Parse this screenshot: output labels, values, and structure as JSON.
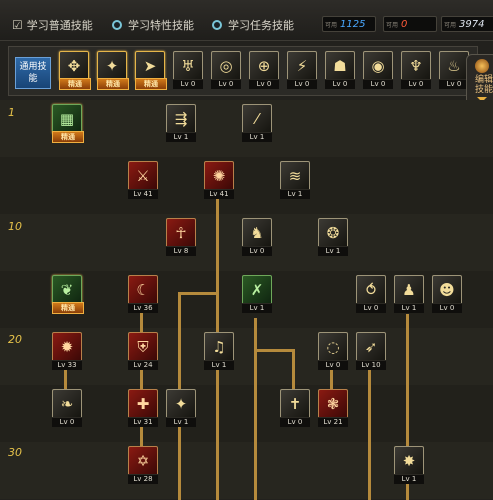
{
  "tabs": [
    {
      "label": "学习普通技能",
      "style": "checkbox"
    },
    {
      "label": "学习特性技能",
      "style": "radio"
    },
    {
      "label": "学习任务技能",
      "style": "radio"
    }
  ],
  "points": [
    {
      "label": "可用",
      "value": "1125",
      "color": "#4aa8ff"
    },
    {
      "label": "可用",
      "value": "0",
      "color": "#ff5a3a"
    },
    {
      "label": "可用",
      "value": "3974",
      "color": "#dfe6f0"
    }
  ],
  "common_label": "通用技能",
  "side_button": "编辑技能",
  "master_label": "精通",
  "level_markers": [
    "1",
    "10",
    "20",
    "30"
  ],
  "common_skills": [
    {
      "icon": "meditate-icon",
      "glyph": "✥",
      "lv": "精通",
      "master": true
    },
    {
      "icon": "leap-icon",
      "glyph": "✦",
      "lv": "精通",
      "master": true
    },
    {
      "icon": "dash-icon",
      "glyph": "➤",
      "lv": "精通",
      "master": true
    },
    {
      "icon": "wings-icon",
      "glyph": "♅",
      "lv": "Lv 0"
    },
    {
      "icon": "target-icon",
      "glyph": "◎",
      "lv": "Lv 0"
    },
    {
      "icon": "crosshair-icon",
      "glyph": "⊕",
      "lv": "Lv 0"
    },
    {
      "icon": "strike-icon",
      "glyph": "⚡",
      "lv": "Lv 0"
    },
    {
      "icon": "kneel-icon",
      "glyph": "☗",
      "lv": "Lv 0"
    },
    {
      "icon": "eye-icon",
      "glyph": "◉",
      "lv": "Lv 0"
    },
    {
      "icon": "flex-icon",
      "glyph": "♆",
      "lv": "Lv 0"
    },
    {
      "icon": "torch-icon",
      "glyph": "♨",
      "lv": "Lv 0"
    }
  ],
  "tree_skills": [
    {
      "id": "s1",
      "icon": "green-grid-icon",
      "glyph": "▦",
      "lv": "精通",
      "master": true,
      "style": "green"
    },
    {
      "id": "s2",
      "icon": "run-icon",
      "glyph": "⇶",
      "lv": "Lv 1"
    },
    {
      "id": "s3",
      "icon": "slash-icon",
      "glyph": "⁄",
      "lv": "Lv 1"
    },
    {
      "id": "s4",
      "icon": "sword-cross-icon",
      "glyph": "⚔",
      "lv": "Lv 41",
      "style": "red"
    },
    {
      "id": "s5",
      "icon": "fire-kick-icon",
      "glyph": "✺",
      "lv": "Lv 41",
      "style": "red"
    },
    {
      "id": "s6",
      "icon": "wind-icon",
      "glyph": "≋",
      "lv": "Lv 1"
    },
    {
      "id": "s7",
      "icon": "ankh-icon",
      "glyph": "☥",
      "lv": "Lv 8",
      "style": "red"
    },
    {
      "id": "s8",
      "icon": "boot-icon",
      "glyph": "♞",
      "lv": "Lv 0"
    },
    {
      "id": "s9",
      "icon": "beast-icon",
      "glyph": "❂",
      "lv": "Lv 1"
    },
    {
      "id": "s10",
      "icon": "green-feather-icon",
      "glyph": "❦",
      "lv": "精通",
      "master": true,
      "style": "green"
    },
    {
      "id": "s11",
      "icon": "crescent-icon",
      "glyph": "☾",
      "lv": "Lv 36",
      "style": "red"
    },
    {
      "id": "s12",
      "icon": "swords-icon",
      "glyph": "✗",
      "lv": "Lv 1",
      "style": "green"
    },
    {
      "id": "s13",
      "icon": "warp-icon",
      "glyph": "⥀",
      "lv": "Lv 0"
    },
    {
      "id": "s14",
      "icon": "figure-icon",
      "glyph": "♟",
      "lv": "Lv 1"
    },
    {
      "id": "s15",
      "icon": "mask-icon",
      "glyph": "☻",
      "lv": "Lv 0"
    },
    {
      "id": "s16",
      "icon": "burst-icon",
      "glyph": "✹",
      "lv": "Lv 33",
      "style": "red"
    },
    {
      "id": "s17",
      "icon": "shield-icon",
      "glyph": "⛨",
      "lv": "Lv 24",
      "style": "red"
    },
    {
      "id": "s18",
      "icon": "music-icon",
      "glyph": "♫",
      "lv": "Lv 1"
    },
    {
      "id": "s19",
      "icon": "cyclone-icon",
      "glyph": "◌",
      "lv": "Lv 0"
    },
    {
      "id": "s20",
      "icon": "spear-icon",
      "glyph": "➶",
      "lv": "Lv 10"
    },
    {
      "id": "s21",
      "icon": "claw-icon",
      "glyph": "❧",
      "lv": "Lv 0"
    },
    {
      "id": "s22",
      "icon": "cross-shield-icon",
      "glyph": "✚",
      "lv": "Lv 31",
      "style": "red"
    },
    {
      "id": "s23",
      "icon": "flame-icon",
      "glyph": "✦",
      "lv": "Lv 1"
    },
    {
      "id": "s24",
      "icon": "holy-cross-icon",
      "glyph": "✝",
      "lv": "Lv 0"
    },
    {
      "id": "s25",
      "icon": "fireball-icon",
      "glyph": "❃",
      "lv": "Lv 21",
      "style": "red"
    },
    {
      "id": "s26",
      "icon": "hexagram-icon",
      "glyph": "✡",
      "lv": "Lv 28",
      "style": "red"
    },
    {
      "id": "s27",
      "icon": "star-burst-icon",
      "glyph": "✸",
      "lv": "Lv 1"
    }
  ]
}
